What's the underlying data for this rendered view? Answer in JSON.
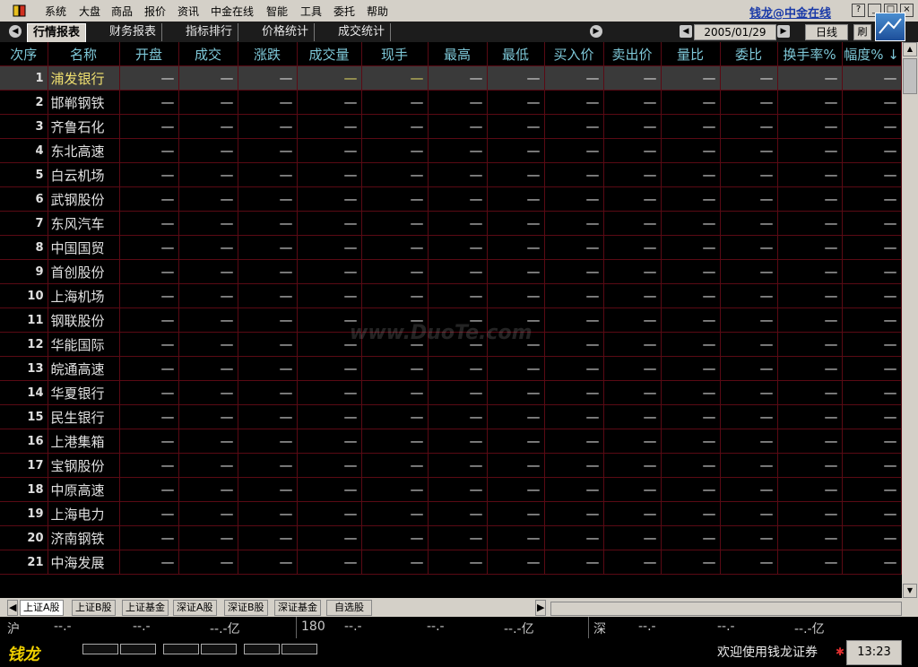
{
  "menu": [
    "系统",
    "大盘",
    "商品",
    "报价",
    "资讯",
    "中金在线",
    "智能",
    "工具",
    "委托",
    "帮助"
  ],
  "brand": "钱龙@中金在线",
  "tabs": [
    "行情报表",
    "财务报表",
    "指标排行",
    "价格统计",
    "成交统计"
  ],
  "date": "2005/01/29",
  "period": "日线",
  "refresh": "刷",
  "headers": [
    "次序",
    "名称",
    "开盘",
    "成交",
    "涨跌",
    "成交量",
    "现手",
    "最高",
    "最低",
    "买入价",
    "卖出价",
    "量比",
    "委比",
    "换手率%",
    "幅度% ↓"
  ],
  "empty_value": "—",
  "rows": [
    {
      "idx": "1",
      "name": "浦发银行"
    },
    {
      "idx": "2",
      "name": "邯郸钢铁"
    },
    {
      "idx": "3",
      "name": "齐鲁石化"
    },
    {
      "idx": "4",
      "name": "东北高速"
    },
    {
      "idx": "5",
      "name": "白云机场"
    },
    {
      "idx": "6",
      "name": "武钢股份"
    },
    {
      "idx": "7",
      "name": "东风汽车"
    },
    {
      "idx": "8",
      "name": "中国国贸"
    },
    {
      "idx": "9",
      "name": "首创股份"
    },
    {
      "idx": "10",
      "name": "上海机场"
    },
    {
      "idx": "11",
      "name": "钢联股份"
    },
    {
      "idx": "12",
      "name": "华能国际"
    },
    {
      "idx": "13",
      "name": "皖通高速"
    },
    {
      "idx": "14",
      "name": "华夏银行"
    },
    {
      "idx": "15",
      "name": "民生银行"
    },
    {
      "idx": "16",
      "name": "上港集箱"
    },
    {
      "idx": "17",
      "name": "宝钢股份"
    },
    {
      "idx": "18",
      "name": "中原高速"
    },
    {
      "idx": "19",
      "name": "上海电力"
    },
    {
      "idx": "20",
      "name": "济南钢铁"
    },
    {
      "idx": "21",
      "name": "中海发展"
    }
  ],
  "watermark": "www.DuoTe.com",
  "market_tabs": [
    "上证A股",
    "上证B股",
    "上证基金",
    "深证A股",
    "深证B股",
    "深证基金",
    "自选股"
  ],
  "index_bar": {
    "sh_label": "沪",
    "sh_a": "--.-",
    "sh_b": "--.-",
    "sh_c": "--.-亿",
    "mid_label": "180",
    "mid_a": "--.-",
    "mid_b": "--.-",
    "mid_c": "--.-亿",
    "sz_label": "深",
    "sz_a": "--.-",
    "sz_b": "--.-",
    "sz_c": "--.-亿"
  },
  "status": {
    "logo": "钱龙",
    "welcome": "欢迎使用钱龙证券",
    "time": "13:23"
  }
}
